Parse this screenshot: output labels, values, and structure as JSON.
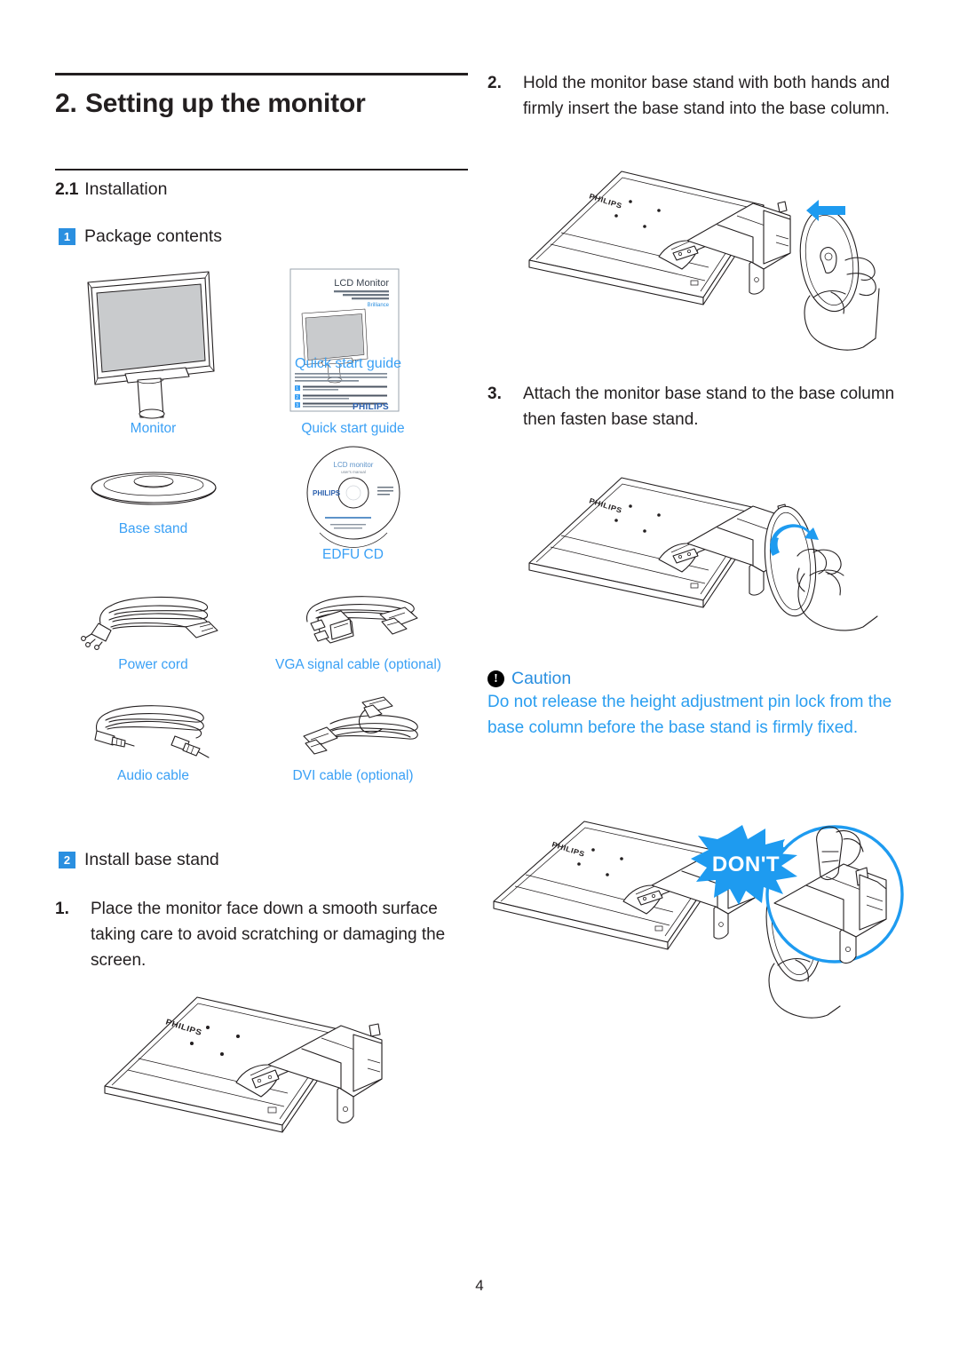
{
  "document": {
    "chapter_number": "2.",
    "chapter_title": "Setting up the monitor",
    "section_number": "2.1",
    "section_title": "Installation",
    "page_number": "4"
  },
  "accent_colors": {
    "badge_blue": "#2a8fe0",
    "caption_blue": "#3aa0f5",
    "caution_blue": "#2a9ef0",
    "arrow_blue": "#1e9bf0",
    "text_black": "#231f20",
    "screen_gray": "#c9cbcd"
  },
  "package_contents": {
    "badge": "1",
    "heading": "Package contents",
    "items": [
      {
        "id": "monitor",
        "caption": "Monitor",
        "icon": "monitor-illustration"
      },
      {
        "id": "quick-guide",
        "caption": "Quick start guide",
        "icon": "booklet-illustration"
      },
      {
        "id": "base-stand",
        "caption": "Base stand",
        "icon": "base-stand-illustration"
      },
      {
        "id": "edfu-cd",
        "caption": "EDFU CD",
        "icon": "cd-disc-illustration"
      },
      {
        "id": "power-cord",
        "caption": "Power cord",
        "icon": "power-cord-illustration"
      },
      {
        "id": "vga-cable",
        "caption": "VGA signal cable (optional)",
        "icon": "vga-cable-illustration"
      },
      {
        "id": "audio-cable",
        "caption": "Audio cable",
        "icon": "audio-cable-illustration"
      },
      {
        "id": "dvi-cable",
        "caption": "DVI cable (optional)",
        "icon": "dvi-cable-illustration"
      }
    ]
  },
  "booklet_art": {
    "header": "LCD Monitor",
    "title": "Quick start guide",
    "brand": "PHILIPS",
    "step_badges": [
      "1",
      "2",
      "3"
    ]
  },
  "cd_art": {
    "line1": "LCD monitor",
    "line2": "user's manual",
    "brand": "PHILIPS"
  },
  "install_base_stand": {
    "badge": "2",
    "heading": "Install base stand"
  },
  "steps": [
    {
      "number": "1.",
      "text": "Place the monitor face down a smooth surface taking care to avoid scratching or damaging the screen."
    },
    {
      "number": "2.",
      "text": "Hold the monitor base stand with both hands and firmly insert the base stand into the base column."
    },
    {
      "number": "3.",
      "text": "Attach the monitor base stand to the base column then fasten base stand."
    }
  ],
  "caution": {
    "icon_glyph": "!",
    "title": "Caution",
    "body": "Do not release the height adjustment pin lock from the base column before the base stand is firmly fixed."
  },
  "diagrams": [
    {
      "id": "diag-step1",
      "alt": "Monitor lying face down with base column attached"
    },
    {
      "id": "diag-step2",
      "alt": "Hands inserting base stand into base column, blue straight arrow"
    },
    {
      "id": "diag-step3",
      "alt": "Hand fastening base stand, blue rotating arrow"
    },
    {
      "id": "diag-dont",
      "alt": "Do-not illustration with DON'T starburst badge"
    }
  ],
  "dont_badge": {
    "label": "DON'T"
  },
  "brand_mark": "PHILIPS"
}
